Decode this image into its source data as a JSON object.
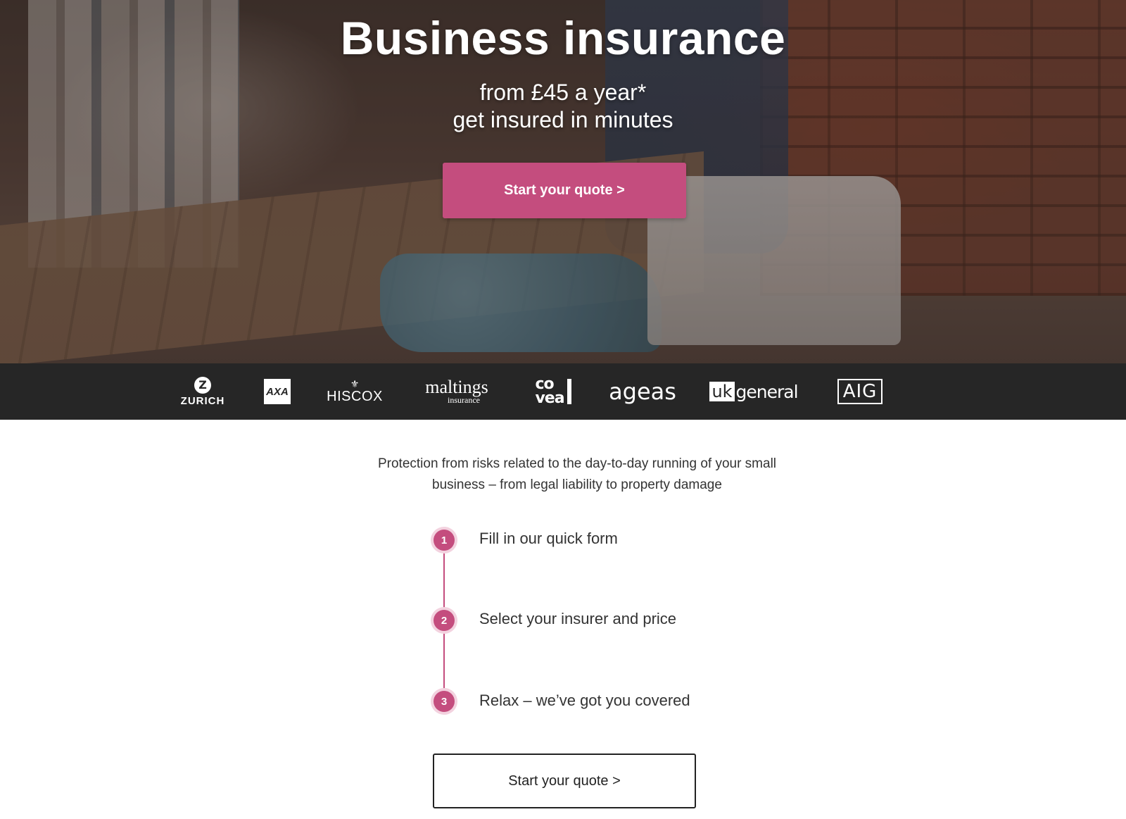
{
  "hero": {
    "title": "Business insurance",
    "subtitle_line1": "from £45 a year*",
    "subtitle_line2": "get insured in minutes",
    "cta_label": "Start your quote >"
  },
  "partners": {
    "zurich": "ZURICH",
    "zurich_mark": "Z",
    "axa": "AXA",
    "hiscox": "HISCOX",
    "maltings": "maltings",
    "maltings_sub": "insurance",
    "covea": "co\nvea",
    "ageas": "ageas",
    "uk": "uk",
    "general": "general",
    "aig": "AIG"
  },
  "intro": "Protection from risks related to the day-to-day running of your small business – from legal liability to property damage",
  "steps": [
    {
      "number": "1",
      "text": "Fill in our quick form"
    },
    {
      "number": "2",
      "text": "Select your insurer and price"
    },
    {
      "number": "3",
      "text": "Relax – we’ve got you covered"
    }
  ],
  "bottom_cta_label": "Start your quote >",
  "colors": {
    "accent": "#c44d7e",
    "partner_bar": "#262626"
  }
}
